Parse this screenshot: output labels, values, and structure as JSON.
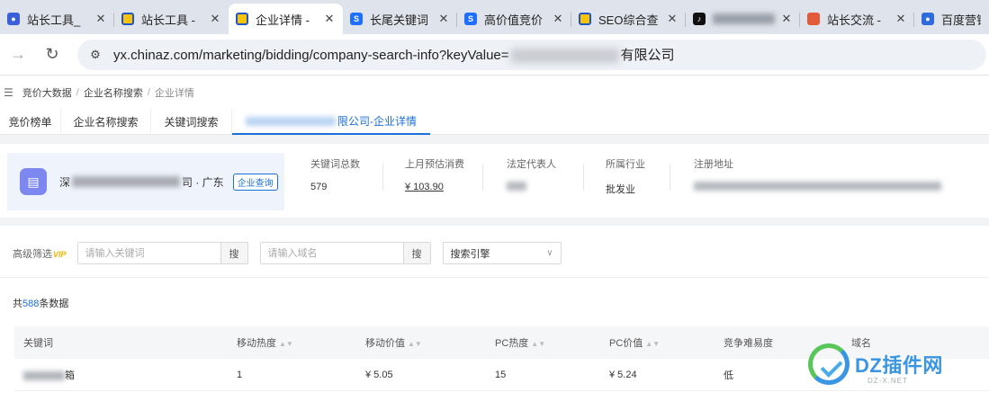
{
  "browser": {
    "tabs": [
      {
        "title": "站长工具_",
        "favicon": "paw-icon",
        "active": false
      },
      {
        "title": "站长工具 -",
        "favicon": "chinaz-icon",
        "active": false
      },
      {
        "title": "企业详情 -",
        "favicon": "chinaz-icon",
        "active": true
      },
      {
        "title": "长尾关键词",
        "favicon": "s-icon",
        "active": false
      },
      {
        "title": "高价值竞价",
        "favicon": "s-icon",
        "active": false
      },
      {
        "title": "SEO综合查",
        "favicon": "chinaz-icon",
        "active": false
      },
      {
        "title": "",
        "favicon": "tiktok-icon",
        "active": false
      },
      {
        "title": "站长交流 -",
        "favicon": "chat-icon",
        "active": false
      },
      {
        "title": "百度营销 -",
        "favicon": "baidu-icon",
        "active": false
      }
    ],
    "close_glyph": "✕",
    "url_prefix": "yx.chinaz.com/marketing/bidding/company-search-info?keyValue=",
    "url_suffix": "有限公司"
  },
  "breadcrumb": {
    "items": [
      "竞价大数据",
      "企业名称搜索",
      "企业详情"
    ]
  },
  "subtabs": [
    "竞价榜单",
    "企业名称搜索",
    "关键词搜索",
    "限公司-企业详情"
  ],
  "company": {
    "name_prefix": "深",
    "name_suffix": "司 · 广东",
    "query_button": "企业查询",
    "stats": [
      {
        "label": "关键词总数",
        "value": "579"
      },
      {
        "label": "上月预估消费",
        "value": "¥ 103.90"
      },
      {
        "label": "法定代表人",
        "value": ""
      },
      {
        "label": "所属行业",
        "value": "批发业"
      },
      {
        "label": "注册地址",
        "value": ""
      }
    ]
  },
  "filter": {
    "label": "高级筛选",
    "vip": "VIP",
    "keyword_placeholder": "请输入关键词",
    "domain_placeholder": "请输入域名",
    "search_button": "搜",
    "engine_select": "搜索引擎"
  },
  "total": {
    "prefix": "共",
    "count": "588",
    "suffix": "条数据"
  },
  "table": {
    "columns": [
      "关键词",
      "移动热度",
      "移动价值",
      "PC热度",
      "PC价值",
      "竞争难易度",
      "域名"
    ],
    "rows": [
      {
        "keyword_suffix": "箱",
        "mobile_heat": "1",
        "mobile_value": "¥ 5.05",
        "pc_heat": "15",
        "pc_value": "¥ 5.24",
        "difficulty": "低",
        "domain": ""
      }
    ]
  },
  "watermark": {
    "text": "DZ插件网",
    "sub": "DZ-X.NET"
  },
  "colors": {
    "accent": "#1b6fd8",
    "tab_strip": "#dfe3eb",
    "page_bg": "#f2f3f5"
  }
}
